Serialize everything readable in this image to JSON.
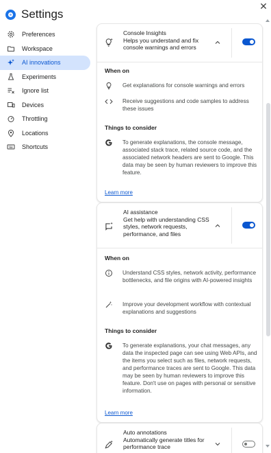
{
  "header": {
    "title": "Settings"
  },
  "sidebar": {
    "items": [
      {
        "label": "Preferences",
        "icon": "gear-icon"
      },
      {
        "label": "Workspace",
        "icon": "folder-icon"
      },
      {
        "label": "AI innovations",
        "icon": "sparkle-icon",
        "active": true
      },
      {
        "label": "Experiments",
        "icon": "flask-icon"
      },
      {
        "label": "Ignore list",
        "icon": "ignore-list-icon"
      },
      {
        "label": "Devices",
        "icon": "devices-icon"
      },
      {
        "label": "Throttling",
        "icon": "speedometer-icon"
      },
      {
        "label": "Locations",
        "icon": "location-pin-icon"
      },
      {
        "label": "Shortcuts",
        "icon": "keyboard-icon"
      }
    ]
  },
  "cards": {
    "console_insights": {
      "title": "Console Insights",
      "desc": "Helps you understand and fix console warnings and errors",
      "toggle": "on",
      "when_on_title": "When on",
      "when_on": [
        "Get explanations for console warnings and errors",
        "Receive suggestions and code samples to address these issues"
      ],
      "consider_title": "Things to consider",
      "consider_text": "To generate explanations, the console message, associated stack trace, related source code, and the associated network headers are sent to Google. This data may be seen by human reviewers to improve this feature.",
      "learn_more": "Learn more"
    },
    "ai_assistance": {
      "title": "AI assistance",
      "desc": "Get help with understanding CSS styles, network requests, performance, and files",
      "toggle": "on",
      "when_on_title": "When on",
      "when_on": [
        "Understand CSS styles, network activity, performance bottlenecks, and file origins with AI-powered insights",
        "Improve your development workflow with contextual explanations and suggestions"
      ],
      "consider_title": "Things to consider",
      "consider_text": "To generate explanations, your chat messages, any data the inspected page can see using Web APIs, and the items you select such as files, network requests, and performance traces are sent to Google. This data may be seen by human reviewers to improve this feature. Don't use on pages with personal or sensitive information.",
      "learn_more": "Learn more"
    },
    "auto_annotations": {
      "title": "Auto annotations",
      "desc": "Automatically generate titles for performance trace",
      "toggle": "off"
    }
  },
  "colors": {
    "accent": "#0b57d0",
    "active_bg": "#d3e3fd"
  }
}
